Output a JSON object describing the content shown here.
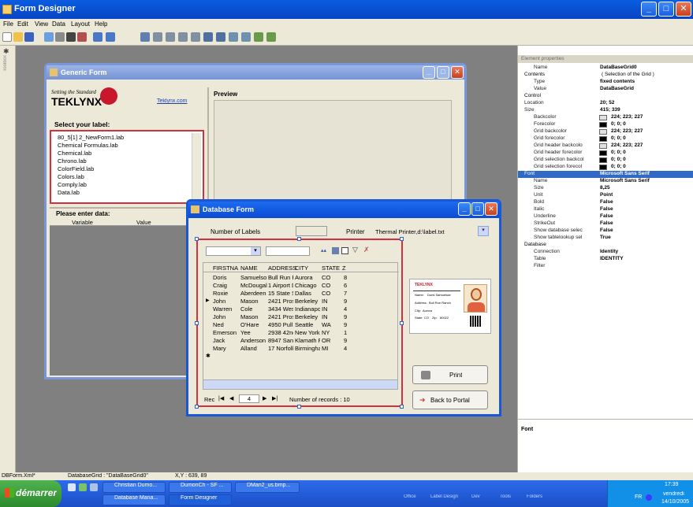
{
  "app": {
    "title": "Form Designer"
  },
  "menu": [
    "File",
    "Edit",
    "View",
    "Data",
    "Layout",
    "Help"
  ],
  "toolbox": {
    "label": "Toolbox"
  },
  "generic_form": {
    "title": "Generic Form",
    "tagline": "Setting the Standard",
    "brand": "TEKLYNX",
    "link": "Teklynx.com",
    "preview_label": "Preview",
    "select_label": "Select your label:",
    "labels": [
      "80_5[1] 2_NewForm1.lab",
      "Chemical Formulas.lab",
      "Chemical.lab",
      "Chrono.lab",
      "ColorField.lab",
      "Colors.lab",
      "Comply.lab",
      "Data.lab"
    ],
    "data_header": "Please enter data:",
    "col_variable": "Variable",
    "col_value": "Value"
  },
  "database_form": {
    "title": "Database Form",
    "number_of_labels": "Number of Labels",
    "printer_label": "Printer",
    "printer_value": "Thermal Printer,d:\\label.txt",
    "columns": [
      "FIRSTNA",
      "NAME",
      "ADDRESS",
      "CITY",
      "STATE",
      "Z"
    ],
    "rows": [
      [
        "Doris",
        "Samuelso",
        "Bull Run R",
        "Aurora",
        "CO",
        "8"
      ],
      [
        "Craig",
        "McDougal",
        "1 Airport D",
        "Chicago",
        "CO",
        "6"
      ],
      [
        "Roxie",
        "Aberdeen",
        "15 State S",
        "Dallas",
        "CO",
        "7"
      ],
      [
        "John",
        "Mason",
        "2421 Pros",
        "Berkeley",
        "IN",
        "9"
      ],
      [
        "Warren",
        "Cole",
        "3434 Wes",
        "Indianapoli",
        "IN",
        "4"
      ],
      [
        "John",
        "Mason",
        "2421 Pros",
        "Berkeley",
        "IN",
        "9"
      ],
      [
        "Ned",
        "O'Hare",
        "4950 Pull",
        "Seattle",
        "WA",
        "9"
      ],
      [
        "Emerson",
        "Yee",
        "2938 42nd",
        "New York",
        "NY",
        "1"
      ],
      [
        "Jack",
        "Anderson",
        "8947 San",
        "Klamath F",
        "OR",
        "9"
      ],
      [
        "Mary",
        "Alland",
        "17 Norfolk",
        "Birmingha",
        "MI",
        "4"
      ]
    ],
    "rec_label": "Rec",
    "rec_value": "4",
    "records_text": "Number of records : 10",
    "print_button": "Print",
    "back_button": "Back to Portal",
    "card": {
      "brand": "TEKLYNX",
      "name_label": "Name:",
      "name_value": "Doris Samuelson",
      "address_label": "Address:",
      "address_value": "Bull Run Ranch",
      "city_label": "City:",
      "city_value": "Aurora",
      "state_label": "State:",
      "state_value": "CO",
      "zip_label": "Zip:",
      "zip_value": "80022"
    }
  },
  "properties": {
    "header": "Element properties",
    "rows": [
      {
        "name": "Name",
        "value": "DataBaseGrid0",
        "kind": "prop"
      },
      {
        "name": "Contents",
        "value": "( Selection of the Grid )",
        "kind": "group"
      },
      {
        "name": "Type",
        "value": "fixed contents",
        "kind": "prop"
      },
      {
        "name": "Value",
        "value": "DataBaseGrid",
        "kind": "prop"
      },
      {
        "name": "Control",
        "value": "",
        "kind": "group"
      },
      {
        "name": "Location",
        "value": "20; 52",
        "kind": "groupprop"
      },
      {
        "name": "Size",
        "value": "415; 339",
        "kind": "groupprop"
      },
      {
        "name": "Backcolor",
        "value": "224; 223; 227",
        "kind": "color",
        "color": "#e0dfe3"
      },
      {
        "name": "Forecolor",
        "value": "0; 0; 0",
        "kind": "color",
        "color": "#000000"
      },
      {
        "name": "Grid backcolor",
        "value": "224; 223; 227",
        "kind": "color",
        "color": "#e0dfe3"
      },
      {
        "name": "Grid forecolor",
        "value": "0; 0; 0",
        "kind": "color",
        "color": "#000000"
      },
      {
        "name": "Grid header backcolo",
        "value": "224; 223; 227",
        "kind": "color",
        "color": "#e0dfe3"
      },
      {
        "name": "Grid header forecolor",
        "value": "0; 0; 0",
        "kind": "color",
        "color": "#000000"
      },
      {
        "name": "Grid selection backcol",
        "value": "0; 0; 0",
        "kind": "color",
        "color": "#000000"
      },
      {
        "name": "Grid selection forecol",
        "value": "0; 0; 0",
        "kind": "color",
        "color": "#000000"
      },
      {
        "name": "Font",
        "value": "Microsoft Sans Serif",
        "kind": "selected"
      },
      {
        "name": "Name",
        "value": "Microsoft Sans Serif",
        "kind": "prop"
      },
      {
        "name": "Size",
        "value": "8,25",
        "kind": "prop"
      },
      {
        "name": "Unit",
        "value": "Point",
        "kind": "prop"
      },
      {
        "name": "Bold",
        "value": "False",
        "kind": "prop"
      },
      {
        "name": "Italic",
        "value": "False",
        "kind": "prop"
      },
      {
        "name": "Underline",
        "value": "False",
        "kind": "prop"
      },
      {
        "name": "StrikeOut",
        "value": "False",
        "kind": "prop"
      },
      {
        "name": "Show database selec",
        "value": "False",
        "kind": "prop"
      },
      {
        "name": "Show tablelookup sel",
        "value": "True",
        "kind": "prop"
      },
      {
        "name": "Database",
        "value": "",
        "kind": "group"
      },
      {
        "name": "Connection",
        "value": "Identity",
        "kind": "prop"
      },
      {
        "name": "Table",
        "value": "IDENTITY",
        "kind": "prop"
      },
      {
        "name": "Filter",
        "value": "",
        "kind": "prop"
      }
    ],
    "description_title": "Font"
  },
  "status": {
    "file": "DBForm.Xml*",
    "element": "DatabaseGrid : \"DataBaseGrid0\"",
    "xy": "X,Y : 639, 89"
  },
  "taskbar": {
    "start": "démarrer",
    "items": [
      "Christian Dumo...",
      "DumonCh - SF ...",
      "DMan2_us.bmp...",
      "Database Mana...",
      "Form Designer"
    ],
    "tray_items": [
      "Office",
      "Label Design",
      "Dev",
      "Tools",
      "Folders"
    ],
    "lang": "FR",
    "time": "17:39",
    "day": "vendredi",
    "date": "14/10/2005"
  }
}
